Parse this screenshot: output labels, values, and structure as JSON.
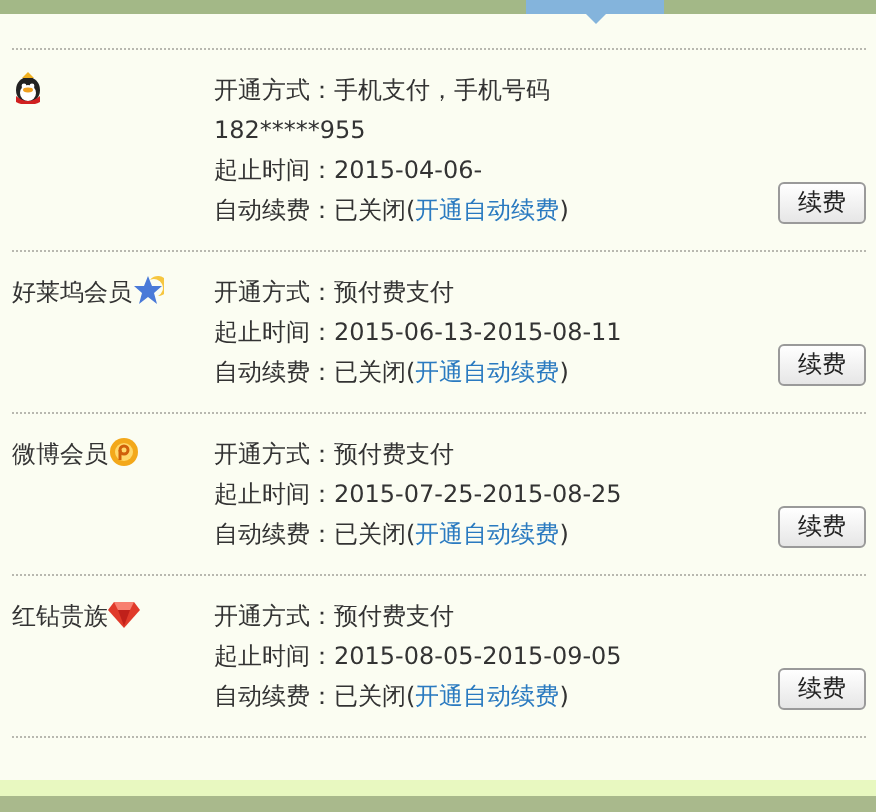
{
  "services": [
    {
      "kind": "penguin",
      "method": "开通方式：手机支付，手机号码182*****955",
      "period": "起止时间：2015-04-06-",
      "renew_prefix": "自动续费：已关闭(",
      "renew_link": "开通自动续费",
      "renew_suffix": ")",
      "button": "续费"
    },
    {
      "name": "好莱坞会员",
      "kind": "star-moon",
      "method": "开通方式：预付费支付",
      "period": "起止时间：2015-06-13-2015-08-11",
      "renew_prefix": "自动续费：已关闭(",
      "renew_link": "开通自动续费",
      "renew_suffix": ")",
      "button": "续费"
    },
    {
      "name": "微博会员",
      "kind": "coin",
      "method": "开通方式：预付费支付",
      "period": "起止时间：2015-07-25-2015-08-25",
      "renew_prefix": "自动续费：已关闭(",
      "renew_link": "开通自动续费",
      "renew_suffix": ")",
      "button": "续费"
    },
    {
      "name": "红钻贵族",
      "kind": "diamond",
      "method": "开通方式：预付费支付",
      "period": "起止时间：2015-08-05-2015-09-05",
      "renew_prefix": "自动续费：已关闭(",
      "renew_link": "开通自动续费",
      "renew_suffix": ")",
      "button": "续费"
    }
  ]
}
